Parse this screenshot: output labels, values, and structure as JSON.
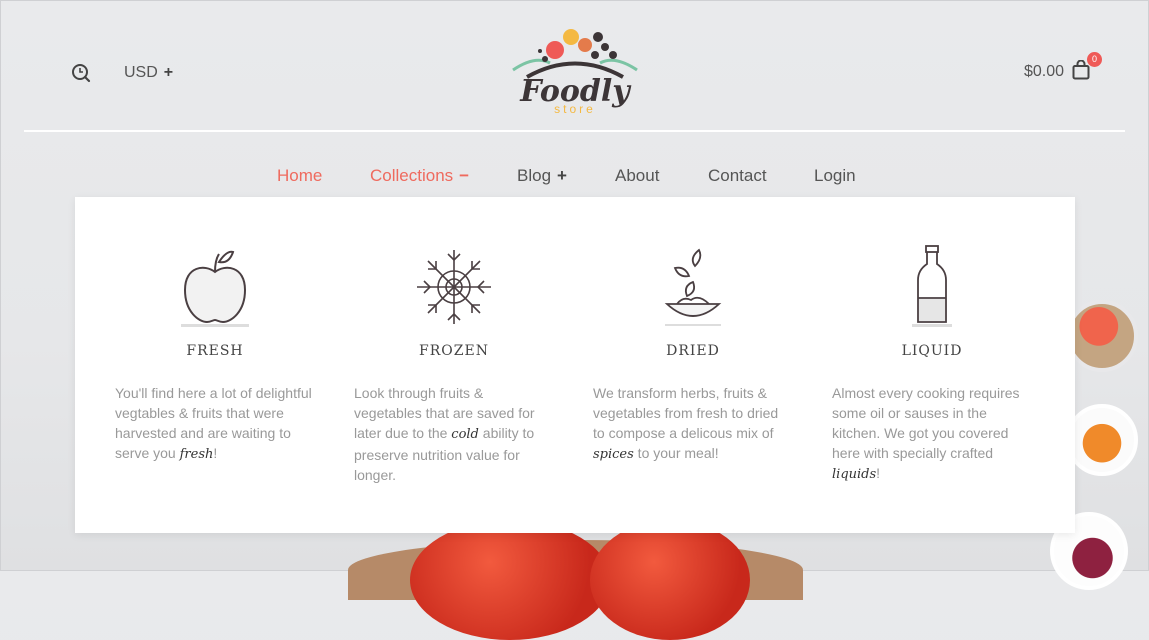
{
  "header": {
    "currency": {
      "label": "USD",
      "toggle": "+"
    },
    "logo": {
      "word": "Foodly",
      "sub": "store"
    },
    "cart": {
      "total": "$0.00",
      "count": "0"
    }
  },
  "nav": {
    "items": [
      {
        "label": "Home",
        "mark": ""
      },
      {
        "label": "Collections",
        "mark": "−"
      },
      {
        "label": "Blog",
        "mark": "+"
      },
      {
        "label": "About",
        "mark": ""
      },
      {
        "label": "Contact",
        "mark": ""
      },
      {
        "label": "Login",
        "mark": ""
      }
    ]
  },
  "mega": {
    "columns": [
      {
        "title": "FRESH",
        "icon": "apple-icon",
        "text_before": "You'll find here a lot of delightful vegtables & fruits that were harvested and are waiting to serve you ",
        "em": "fresh",
        "text_after": "!"
      },
      {
        "title": "FROZEN",
        "icon": "snowflake-icon",
        "text_before": "Look through fruits & vegetables that are saved for later due to the ",
        "em": "cold",
        "text_after": " ability to preserve nutrition value for longer."
      },
      {
        "title": "DRIED",
        "icon": "dried-leaves-bowl-icon",
        "text_before": "We transform herbs, fruits & vegetables from fresh to dried to compose a delicous mix of ",
        "em": "spices",
        "text_after": " to your meal!"
      },
      {
        "title": "LIQUID",
        "icon": "bottle-icon",
        "text_before": "Almost every cooking requires some oil or sauses in the kitchen. We got you covered here with specially crafted ",
        "em": "liquids",
        "text_after": "!"
      }
    ]
  },
  "colors": {
    "accent": "#ef6a5e",
    "badge": "#ef5a57",
    "text": "#555555",
    "muted": "#999999"
  }
}
